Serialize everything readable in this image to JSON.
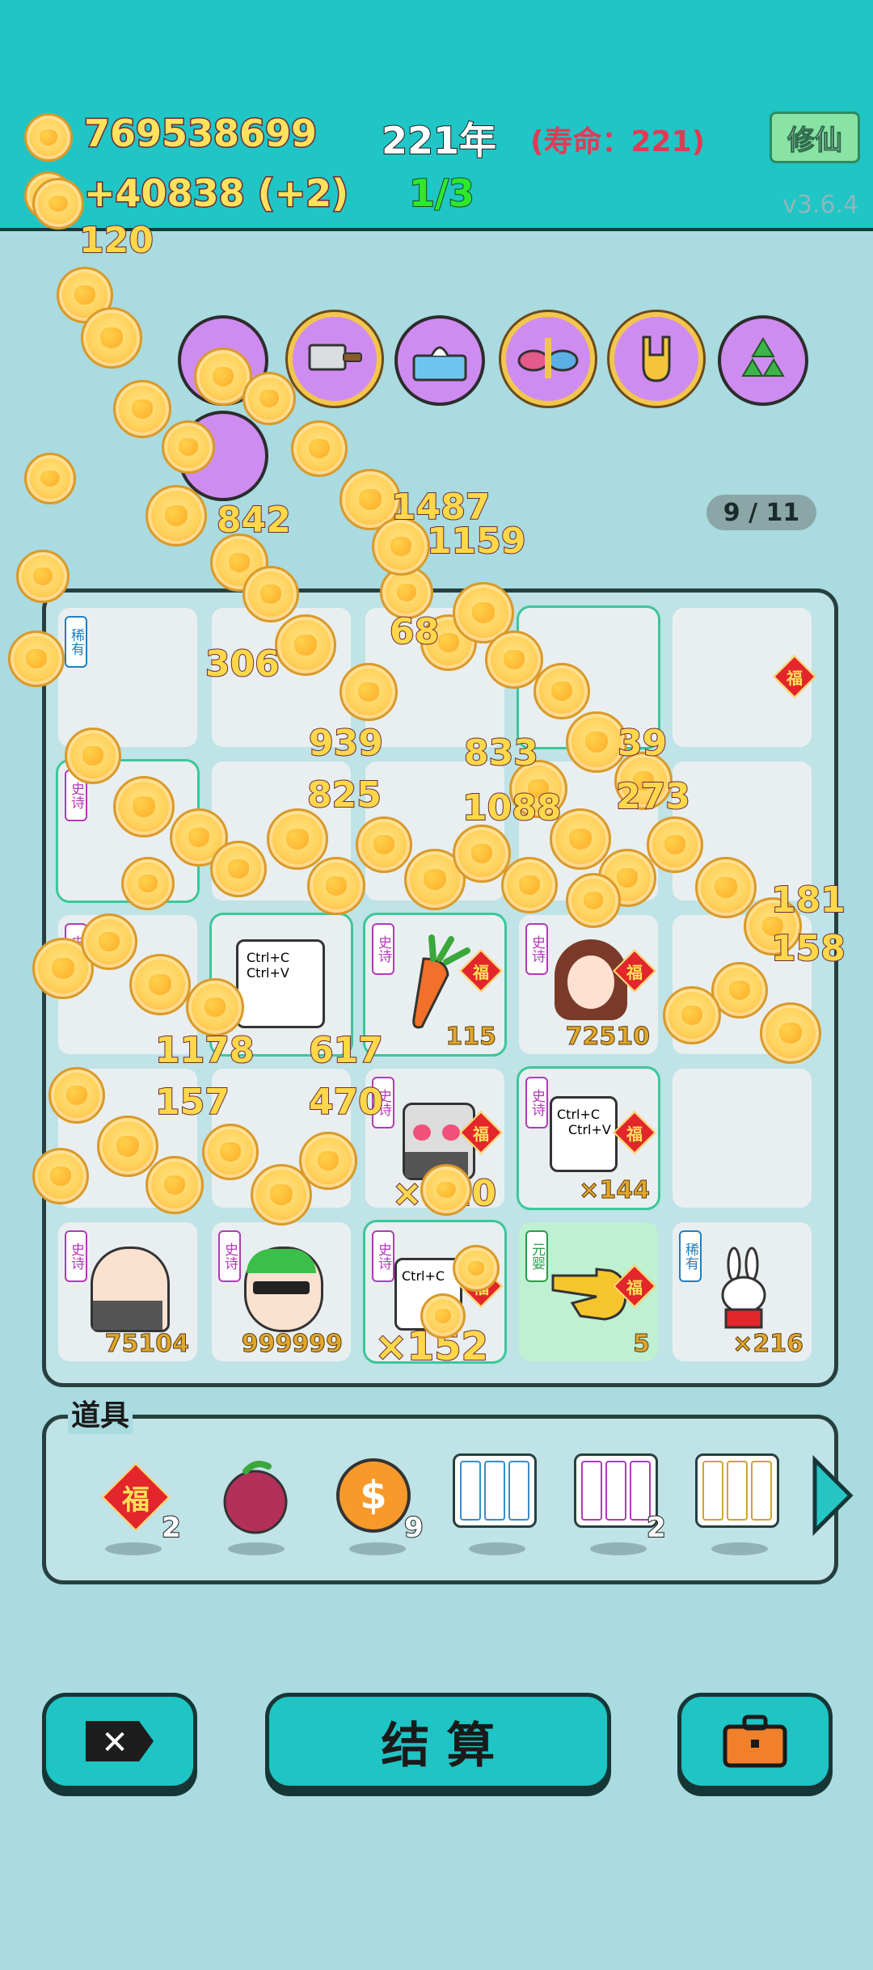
{
  "header": {
    "coins": "769538699",
    "income": "+40838 (+2)",
    "years": "221年",
    "lifespan": "(寿命：221)",
    "progress": "1/3",
    "mode_button": "修仙",
    "version": "v3.6.4"
  },
  "floating_numbers": [
    "120",
    "842",
    "1487",
    "1159",
    "68",
    "306",
    "939",
    "833",
    "39",
    "825",
    "1088",
    "273",
    "181",
    "158",
    "1178",
    "617",
    "157",
    "470"
  ],
  "page_indicator": "9 / 11",
  "board": {
    "tags": {
      "epic": "史诗",
      "rare": "稀有",
      "yuan": "元婴"
    },
    "fu_label": "福",
    "cells_counts": {
      "carrot": "115",
      "girl": "72510",
      "robot_mid": "×120",
      "ctrl_mid": "×144",
      "uncle": "75104",
      "glasses": "999999",
      "ctrl_bottom": "×152",
      "hand": "5",
      "rabbit": "×216"
    },
    "ctrl_text_1": "Ctrl+C",
    "ctrl_text_2": "Ctrl+V"
  },
  "props": {
    "title": "道具",
    "items": [
      {
        "name": "fu-item",
        "count": "2"
      },
      {
        "name": "berry-item",
        "count": ""
      },
      {
        "name": "dollar-coin-item",
        "count": "9"
      },
      {
        "name": "rare-cards-item",
        "count": ""
      },
      {
        "name": "epic-cards-item",
        "count": "2"
      },
      {
        "name": "legend-cards-item",
        "count": ""
      }
    ]
  },
  "buttons": {
    "settle": "结 算",
    "close": "✕"
  },
  "colors": {
    "header": "#20c5c5",
    "background": "#a9dbe0",
    "coin": "#ffd15a",
    "accent_red": "#e2262b",
    "progress_green": "#2ee82e",
    "life_red": "#e23a55"
  }
}
